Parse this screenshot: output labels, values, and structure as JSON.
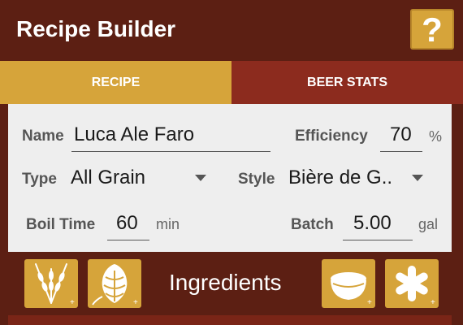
{
  "app": {
    "title": "Recipe Builder",
    "help_label": "?"
  },
  "tabs": [
    {
      "label": "RECIPE",
      "active": true
    },
    {
      "label": "BEER STATS",
      "active": false
    }
  ],
  "recipe": {
    "name_label": "Name",
    "name_value": "Luca Ale Faro",
    "efficiency_label": "Efficiency",
    "efficiency_value": "70",
    "efficiency_unit": "%",
    "type_label": "Type",
    "type_value": "All Grain",
    "style_label": "Style",
    "style_value": "Bière de G..",
    "boil_label": "Boil Time",
    "boil_value": "60",
    "boil_unit": "min",
    "batch_label": "Batch",
    "batch_value": "5.00",
    "batch_unit": "gal"
  },
  "ingredients": {
    "title": "Ingredients",
    "buttons": [
      "add-grain-icon",
      "add-hops-icon",
      "add-yeast-icon",
      "add-misc-icon"
    ]
  },
  "colors": {
    "header_bg": "#5c1f13",
    "accent_gold": "#d6a43a",
    "tab_inactive": "#8c2b1e",
    "panel_bg": "#eeeeee"
  }
}
